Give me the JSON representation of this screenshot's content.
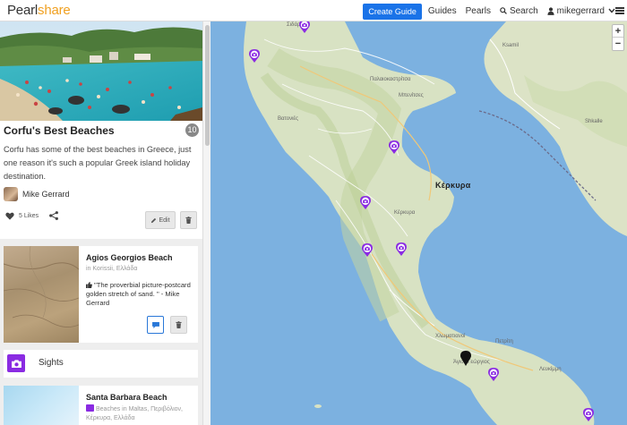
{
  "header": {
    "logo_part1": "Pearl",
    "logo_part2": "share",
    "create_guide": "Create Guide",
    "guides": "Guides",
    "pearls": "Pearls",
    "search": "Search",
    "username": "mikegerrard",
    "brand_color": "#f0a020",
    "accent_color": "#1a73e8"
  },
  "guide": {
    "title": "Corfu's Best Beaches",
    "count": "10",
    "description": "Corfu has some of the best beaches in Greece, just one reason it's such a popular Greek island holiday destination.",
    "author": "Mike Gerrard",
    "likes": "5 Likes",
    "edit_label": "Edit"
  },
  "pearls": [
    {
      "title": "Agios Georgios Beach",
      "location": "in Korissii, Ελλάδα",
      "quote": "\"The proverbial picture-postcard golden stretch of sand. \" - Mike Gerrard"
    },
    {
      "title": "Santa Barbara Beach",
      "meta": "Beaches in Maltas, Περιβόλιον, Κέρκυρα, Ελλάδα"
    }
  ],
  "section": {
    "label": "Sights",
    "color": "#8a2be2"
  },
  "map": {
    "labels": {
      "city": "Κέρκυρα",
      "top_left": "Σιδάρι",
      "palaiokastritsa": "Παλαιοκαστρίτσα",
      "mpeniatses": "Μπενίτσες",
      "ksamil": "Ksamil",
      "shkalle": "Shkalle",
      "vatonies": "Βατονιές",
      "kerkyra_small": "Κέρκυρα",
      "chlomatianoi": "Χλωματιανοί",
      "petriti": "Πετρίτη",
      "agios_georgios": "Άγιος Γεώργιος",
      "lefkimmi": "Λευκίμμη"
    },
    "zoom_in": "+",
    "zoom_out": "−",
    "pin_color": "#8a2be2"
  }
}
